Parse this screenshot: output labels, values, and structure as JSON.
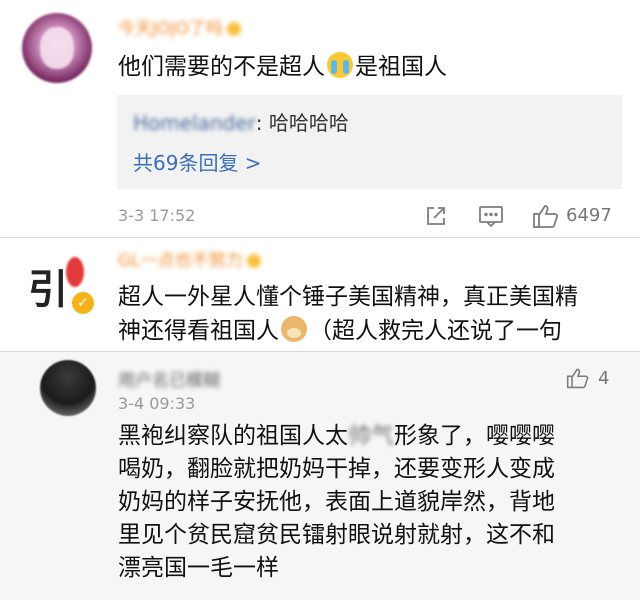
{
  "comments": [
    {
      "user": "今天JOJO了吗",
      "text_before": "他们需要的不是超人",
      "emoji": "cry-emoji",
      "text_after": "是祖国人",
      "reply": {
        "user": "Homelander",
        "text": ": 哈哈哈哈",
        "count_label": "共69条回复 >"
      },
      "time": "3-3 17:52",
      "likes": "6497"
    },
    {
      "user": "GL一点也不努力",
      "line1": "超人一外星人懂个锤子美国精神，真正美国精",
      "line2_before": "神还得看祖国人",
      "emoji": "doge-emoji",
      "line2_after": "（超人救完人还说了一句"
    },
    {
      "user": "用户名已模糊",
      "time": "3-4 09:33",
      "likes": "4",
      "line1_before": "黑袍纠察队的祖国人太",
      "blurred": "帅气",
      "line1_after": "形象了，嘤嘤嘤",
      "line2": "喝奶，翻脸就把奶妈干掉，还要变形人变成",
      "line3": "奶妈的样子安抚他，表面上道貌岸然，背地",
      "line4": "里见个贫民窟贫民镭射眼说射就射，这不和",
      "line5": "漂亮国一毛一样"
    }
  ],
  "colors": {
    "username_vip": "#f08a2a",
    "link": "#3b6fb6",
    "meta": "#999999",
    "badge": "#f5b21b"
  }
}
